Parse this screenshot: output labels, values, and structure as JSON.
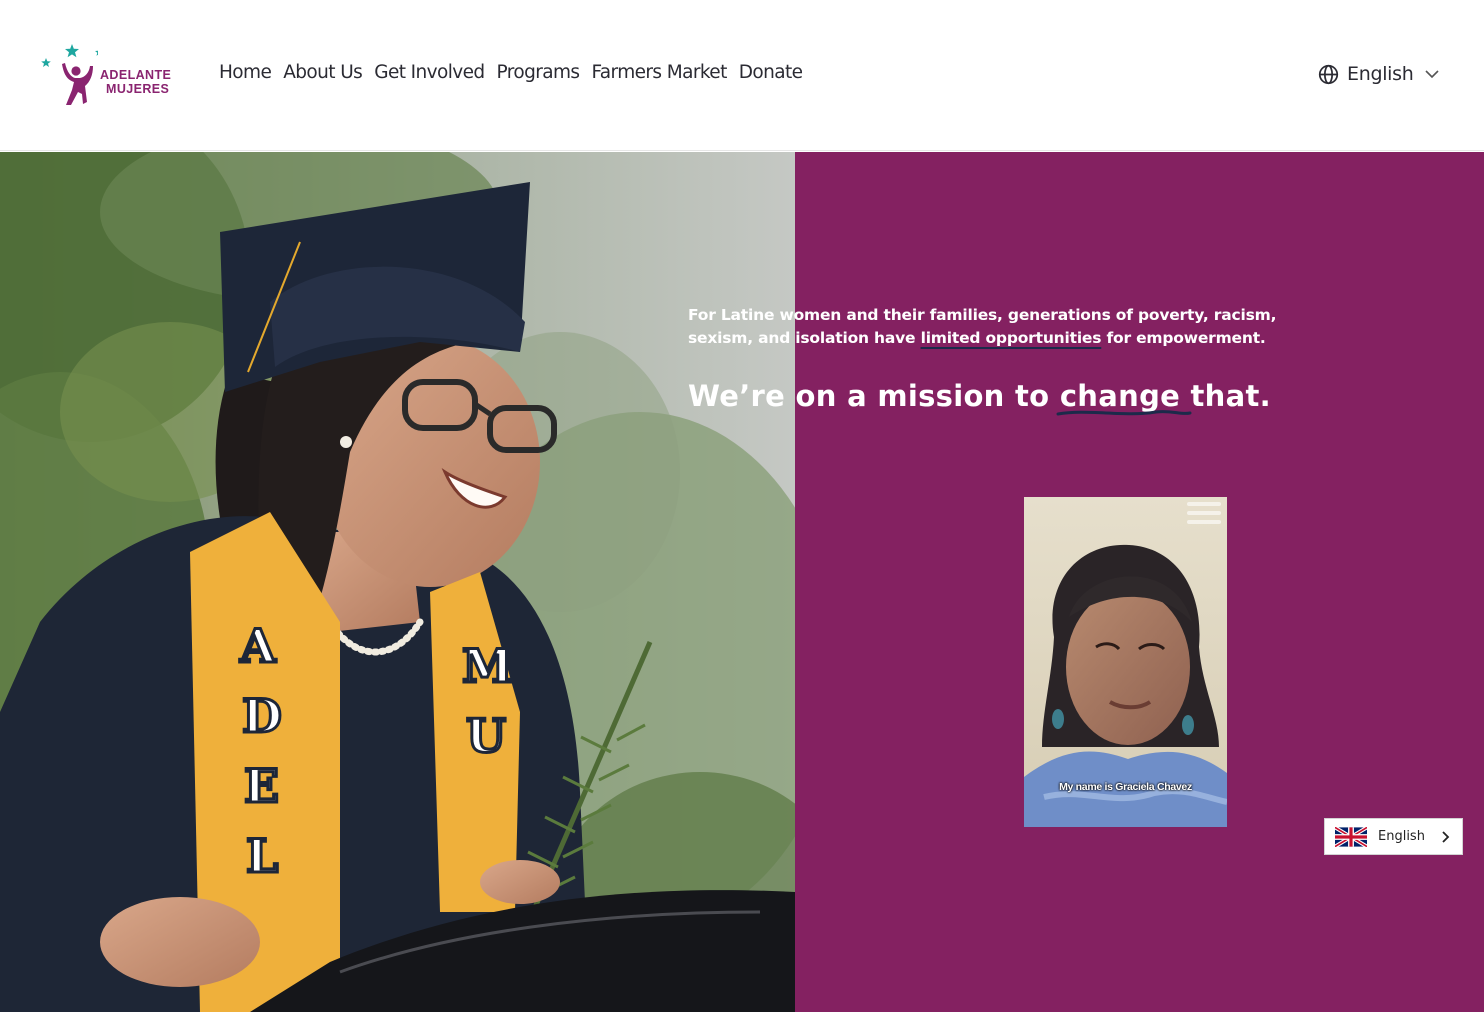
{
  "brand": {
    "name_line1": "ADELANTE",
    "name_line2": "MUJERES",
    "logo_color": "#8a2470",
    "star_color": "#1ea7a0"
  },
  "nav": {
    "items": [
      {
        "label": "Home"
      },
      {
        "label": "About Us"
      },
      {
        "label": "Get Involved"
      },
      {
        "label": "Programs"
      },
      {
        "label": "Farmers Market"
      },
      {
        "label": "Donate"
      }
    ]
  },
  "language_selector": {
    "icon": "globe-icon",
    "selected": "English",
    "chevron": "chevron-down-icon"
  },
  "hero": {
    "panel_color": "#842161",
    "intro_before": "For Latine women and their families, generations of poverty, racism, sexism, and isolation have ",
    "intro_highlight": "limited opportunities",
    "intro_after": " for empowerment.",
    "mission_before": "We’re on a mission to ",
    "mission_highlight": "change",
    "mission_after": " that."
  },
  "video": {
    "caption": "My name is Graciela Chavez"
  },
  "language_widget": {
    "flag": "uk-flag-icon",
    "label": "English",
    "chevron": "chevron-right-icon"
  }
}
